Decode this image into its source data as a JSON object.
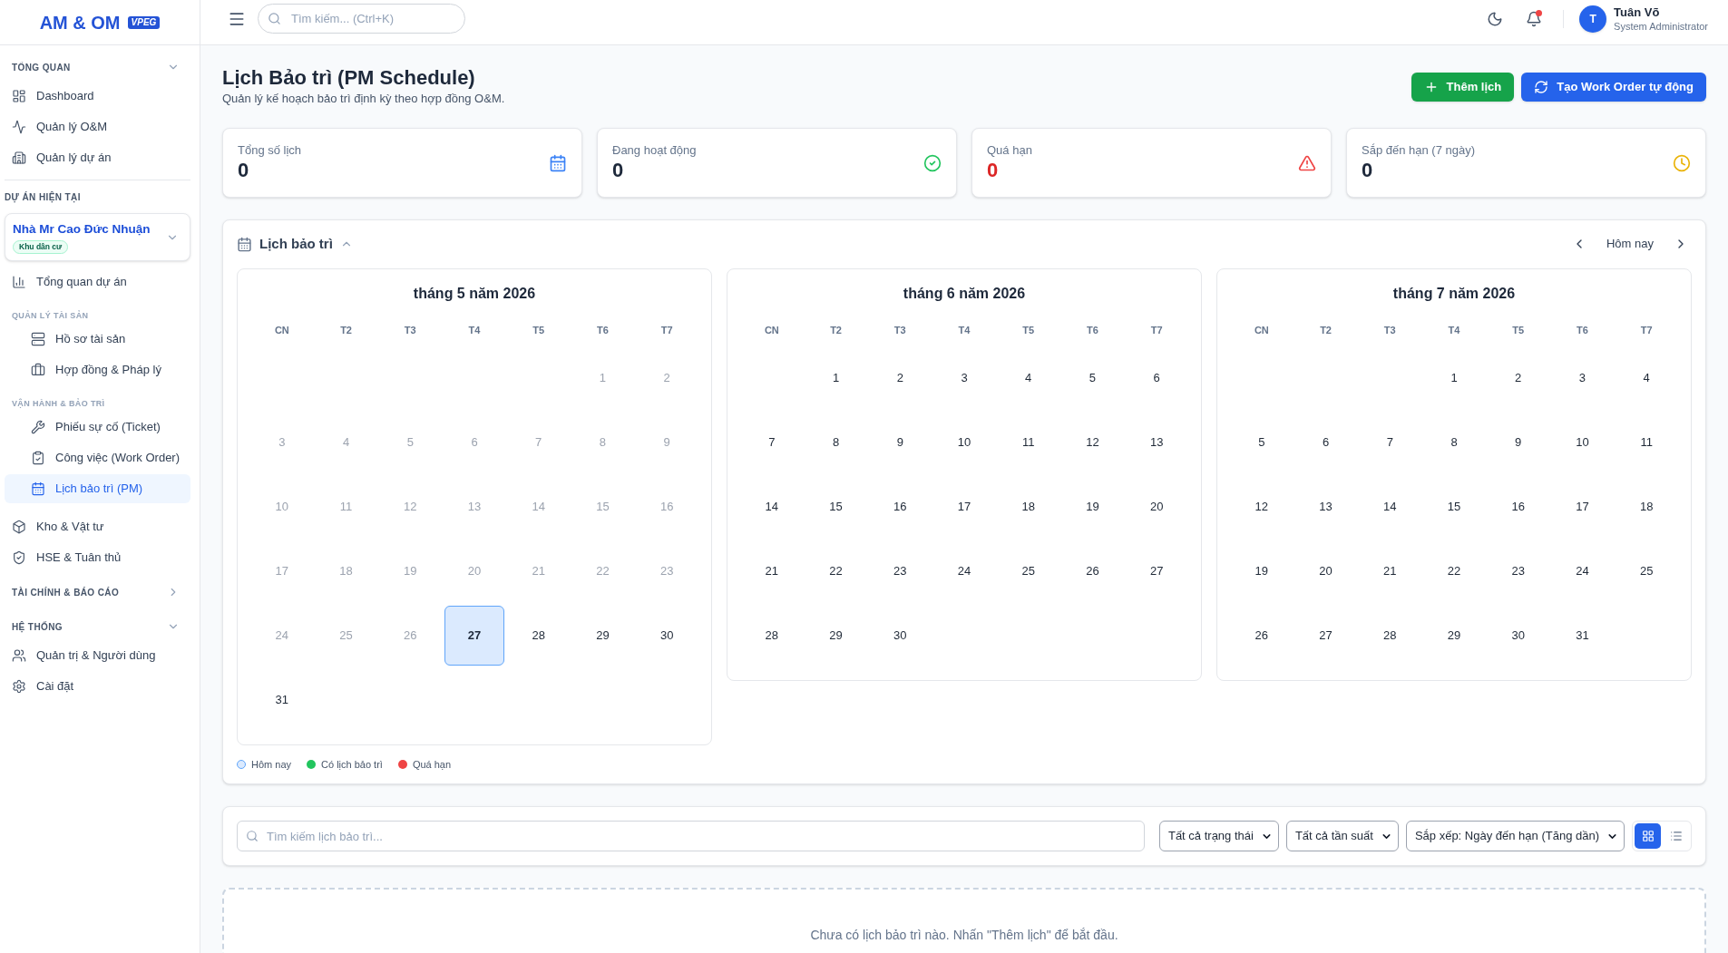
{
  "sidebar": {
    "logo": {
      "title": "AM & OM",
      "badge": "VPEG"
    },
    "sections": [
      {
        "kind": "collapsible",
        "title": "TỔNG QUAN",
        "expanded": true,
        "items": [
          {
            "label": "Dashboard",
            "selected": false
          },
          {
            "label": "Quản lý O&M",
            "selected": false
          },
          {
            "label": "Quản lý dự án",
            "selected": false
          }
        ]
      },
      {
        "kind": "project",
        "title": "DỰ ÁN HIỆN TẠI",
        "project": {
          "name": "Nhà Mr Cao Đức Nhuận",
          "tag": "Khu dân cư"
        },
        "items": [
          {
            "kind": "link",
            "label": "Tổng quan dự án",
            "selected": false
          },
          {
            "kind": "group",
            "title": "QUẢN LÝ TÀI SẢN",
            "items": [
              {
                "label": "Hồ sơ tài sản",
                "selected": false
              },
              {
                "label": "Hợp đồng & Pháp lý",
                "selected": false
              }
            ]
          },
          {
            "kind": "group",
            "title": "VẬN HÀNH & BẢO TRÌ",
            "items": [
              {
                "label": "Phiếu sự cố (Ticket)",
                "selected": false
              },
              {
                "label": "Công việc (Work Order)",
                "selected": false
              },
              {
                "label": "Lịch bảo trì (PM)",
                "selected": true
              }
            ]
          },
          {
            "kind": "link",
            "label": "Kho & Vật tư",
            "selected": false
          },
          {
            "kind": "link",
            "label": "HSE & Tuân thủ",
            "selected": false
          }
        ]
      },
      {
        "kind": "collapsible",
        "title": "TÀI CHÍNH & BÁO CÁO",
        "expanded": false
      },
      {
        "kind": "collapsible",
        "title": "HỆ THỐNG",
        "expanded": true,
        "items": [
          {
            "label": "Quản trị & Người dùng",
            "selected": false
          },
          {
            "label": "Cài đặt",
            "selected": false
          }
        ]
      }
    ]
  },
  "header": {
    "search": {
      "placeholder": "Tìm kiếm... (Ctrl+K)"
    },
    "notifications": {
      "unread": true
    },
    "user": {
      "initial": "T",
      "name": "Tuân Võ",
      "role": "System Administrator"
    }
  },
  "page": {
    "title": "Lịch Bảo trì (PM Schedule)",
    "subtitle": "Quản lý kế hoạch bảo trì định kỳ theo hợp đồng O&M.",
    "actions": [
      {
        "kind": "add",
        "label": "Thêm lịch"
      },
      {
        "kind": "generate",
        "label": "Tạo Work Order tự động"
      }
    ]
  },
  "stats": [
    {
      "kind": "total",
      "label": "Tổng số lịch",
      "value": "0"
    },
    {
      "kind": "active",
      "label": "Đang hoạt động",
      "value": "0"
    },
    {
      "kind": "overdue",
      "label": "Quá hạn",
      "value": "0"
    },
    {
      "kind": "upcoming",
      "label": "Sắp đến hạn (7 ngày)",
      "value": "0"
    }
  ],
  "calendar": {
    "title": "Lịch bảo trì",
    "expanded": true,
    "today_button": "Hôm nay",
    "months": [
      {
        "title": "tháng 5 năm 2026",
        "weekdays": [
          "CN",
          "T2",
          "T3",
          "T4",
          "T5",
          "T6",
          "T7"
        ],
        "weeks": [
          [
            {
              "kind": "blank"
            },
            {
              "kind": "blank"
            },
            {
              "kind": "blank"
            },
            {
              "kind": "blank"
            },
            {
              "kind": "blank"
            },
            {
              "kind": "day",
              "label": "1",
              "past": true,
              "today": false
            },
            {
              "kind": "day",
              "label": "2",
              "past": true,
              "today": false
            }
          ],
          [
            {
              "kind": "day",
              "label": "3",
              "past": true,
              "today": false
            },
            {
              "kind": "day",
              "label": "4",
              "past": true,
              "today": false
            },
            {
              "kind": "day",
              "label": "5",
              "past": true,
              "today": false
            },
            {
              "kind": "day",
              "label": "6",
              "past": true,
              "today": false
            },
            {
              "kind": "day",
              "label": "7",
              "past": true,
              "today": false
            },
            {
              "kind": "day",
              "label": "8",
              "past": true,
              "today": false
            },
            {
              "kind": "day",
              "label": "9",
              "past": true,
              "today": false
            }
          ],
          [
            {
              "kind": "day",
              "label": "10",
              "past": true,
              "today": false
            },
            {
              "kind": "day",
              "label": "11",
              "past": true,
              "today": false
            },
            {
              "kind": "day",
              "label": "12",
              "past": true,
              "today": false
            },
            {
              "kind": "day",
              "label": "13",
              "past": true,
              "today": false
            },
            {
              "kind": "day",
              "label": "14",
              "past": true,
              "today": false
            },
            {
              "kind": "day",
              "label": "15",
              "past": true,
              "today": false
            },
            {
              "kind": "day",
              "label": "16",
              "past": true,
              "today": false
            }
          ],
          [
            {
              "kind": "day",
              "label": "17",
              "past": true,
              "today": false
            },
            {
              "kind": "day",
              "label": "18",
              "past": true,
              "today": false
            },
            {
              "kind": "day",
              "label": "19",
              "past": true,
              "today": false
            },
            {
              "kind": "day",
              "label": "20",
              "past": true,
              "today": false
            },
            {
              "kind": "day",
              "label": "21",
              "past": true,
              "today": false
            },
            {
              "kind": "day",
              "label": "22",
              "past": true,
              "today": false
            },
            {
              "kind": "day",
              "label": "23",
              "past": true,
              "today": false
            }
          ],
          [
            {
              "kind": "day",
              "label": "24",
              "past": true,
              "today": false
            },
            {
              "kind": "day",
              "label": "25",
              "past": true,
              "today": false
            },
            {
              "kind": "day",
              "label": "26",
              "past": true,
              "today": false
            },
            {
              "kind": "day",
              "label": "27",
              "past": false,
              "today": true
            },
            {
              "kind": "day",
              "label": "28",
              "past": false,
              "today": false
            },
            {
              "kind": "day",
              "label": "29",
              "past": false,
              "today": false
            },
            {
              "kind": "day",
              "label": "30",
              "past": false,
              "today": false
            }
          ],
          [
            {
              "kind": "day",
              "label": "31",
              "past": false,
              "today": false
            }
          ]
        ]
      },
      {
        "title": "tháng 6 năm 2026",
        "weekdays": [
          "CN",
          "T2",
          "T3",
          "T4",
          "T5",
          "T6",
          "T7"
        ],
        "weeks": [
          [
            {
              "kind": "blank"
            },
            {
              "kind": "day",
              "label": "1",
              "past": false,
              "today": false
            },
            {
              "kind": "day",
              "label": "2",
              "past": false,
              "today": false
            },
            {
              "kind": "day",
              "label": "3",
              "past": false,
              "today": false
            },
            {
              "kind": "day",
              "label": "4",
              "past": false,
              "today": false
            },
            {
              "kind": "day",
              "label": "5",
              "past": false,
              "today": false
            },
            {
              "kind": "day",
              "label": "6",
              "past": false,
              "today": false
            }
          ],
          [
            {
              "kind": "day",
              "label": "7",
              "past": false,
              "today": false
            },
            {
              "kind": "day",
              "label": "8",
              "past": false,
              "today": false
            },
            {
              "kind": "day",
              "label": "9",
              "past": false,
              "today": false
            },
            {
              "kind": "day",
              "label": "10",
              "past": false,
              "today": false
            },
            {
              "kind": "day",
              "label": "11",
              "past": false,
              "today": false
            },
            {
              "kind": "day",
              "label": "12",
              "past": false,
              "today": false
            },
            {
              "kind": "day",
              "label": "13",
              "past": false,
              "today": false
            }
          ],
          [
            {
              "kind": "day",
              "label": "14",
              "past": false,
              "today": false
            },
            {
              "kind": "day",
              "label": "15",
              "past": false,
              "today": false
            },
            {
              "kind": "day",
              "label": "16",
              "past": false,
              "today": false
            },
            {
              "kind": "day",
              "label": "17",
              "past": false,
              "today": false
            },
            {
              "kind": "day",
              "label": "18",
              "past": false,
              "today": false
            },
            {
              "kind": "day",
              "label": "19",
              "past": false,
              "today": false
            },
            {
              "kind": "day",
              "label": "20",
              "past": false,
              "today": false
            }
          ],
          [
            {
              "kind": "day",
              "label": "21",
              "past": false,
              "today": false
            },
            {
              "kind": "day",
              "label": "22",
              "past": false,
              "today": false
            },
            {
              "kind": "day",
              "label": "23",
              "past": false,
              "today": false
            },
            {
              "kind": "day",
              "label": "24",
              "past": false,
              "today": false
            },
            {
              "kind": "day",
              "label": "25",
              "past": false,
              "today": false
            },
            {
              "kind": "day",
              "label": "26",
              "past": false,
              "today": false
            },
            {
              "kind": "day",
              "label": "27",
              "past": false,
              "today": false
            }
          ],
          [
            {
              "kind": "day",
              "label": "28",
              "past": false,
              "today": false
            },
            {
              "kind": "day",
              "label": "29",
              "past": false,
              "today": false
            },
            {
              "kind": "day",
              "label": "30",
              "past": false,
              "today": false
            }
          ]
        ]
      },
      {
        "title": "tháng 7 năm 2026",
        "weekdays": [
          "CN",
          "T2",
          "T3",
          "T4",
          "T5",
          "T6",
          "T7"
        ],
        "weeks": [
          [
            {
              "kind": "blank"
            },
            {
              "kind": "blank"
            },
            {
              "kind": "blank"
            },
            {
              "kind": "day",
              "label": "1",
              "past": false,
              "today": false
            },
            {
              "kind": "day",
              "label": "2",
              "past": false,
              "today": false
            },
            {
              "kind": "day",
              "label": "3",
              "past": false,
              "today": false
            },
            {
              "kind": "day",
              "label": "4",
              "past": false,
              "today": false
            }
          ],
          [
            {
              "kind": "day",
              "label": "5",
              "past": false,
              "today": false
            },
            {
              "kind": "day",
              "label": "6",
              "past": false,
              "today": false
            },
            {
              "kind": "day",
              "label": "7",
              "past": false,
              "today": false
            },
            {
              "kind": "day",
              "label": "8",
              "past": false,
              "today": false
            },
            {
              "kind": "day",
              "label": "9",
              "past": false,
              "today": false
            },
            {
              "kind": "day",
              "label": "10",
              "past": false,
              "today": false
            },
            {
              "kind": "day",
              "label": "11",
              "past": false,
              "today": false
            }
          ],
          [
            {
              "kind": "day",
              "label": "12",
              "past": false,
              "today": false
            },
            {
              "kind": "day",
              "label": "13",
              "past": false,
              "today": false
            },
            {
              "kind": "day",
              "label": "14",
              "past": false,
              "today": false
            },
            {
              "kind": "day",
              "label": "15",
              "past": false,
              "today": false
            },
            {
              "kind": "day",
              "label": "16",
              "past": false,
              "today": false
            },
            {
              "kind": "day",
              "label": "17",
              "past": false,
              "today": false
            },
            {
              "kind": "day",
              "label": "18",
              "past": false,
              "today": false
            }
          ],
          [
            {
              "kind": "day",
              "label": "19",
              "past": false,
              "today": false
            },
            {
              "kind": "day",
              "label": "20",
              "past": false,
              "today": false
            },
            {
              "kind": "day",
              "label": "21",
              "past": false,
              "today": false
            },
            {
              "kind": "day",
              "label": "22",
              "past": false,
              "today": false
            },
            {
              "kind": "day",
              "label": "23",
              "past": false,
              "today": false
            },
            {
              "kind": "day",
              "label": "24",
              "past": false,
              "today": false
            },
            {
              "kind": "day",
              "label": "25",
              "past": false,
              "today": false
            }
          ],
          [
            {
              "kind": "day",
              "label": "26",
              "past": false,
              "today": false
            },
            {
              "kind": "day",
              "label": "27",
              "past": false,
              "today": false
            },
            {
              "kind": "day",
              "label": "28",
              "past": false,
              "today": false
            },
            {
              "kind": "day",
              "label": "29",
              "past": false,
              "today": false
            },
            {
              "kind": "day",
              "label": "30",
              "past": false,
              "today": false
            },
            {
              "kind": "day",
              "label": "31",
              "past": false,
              "today": false
            }
          ]
        ]
      }
    ],
    "legend": [
      {
        "kind": "outlined",
        "label": "Hôm nay",
        "color": "#dbeafe"
      },
      {
        "kind": "filled",
        "label": "Có lịch bảo trì",
        "color": "#22c55e"
      },
      {
        "kind": "filled",
        "label": "Quá hạn",
        "color": "#ef4444"
      }
    ]
  },
  "filters": {
    "search": {
      "placeholder": "Tìm kiếm lịch bảo trì..."
    },
    "selects": [
      "Tất cả trạng thái",
      "Tất cả tần suất",
      "Sắp xếp: Ngày đến hạn (Tăng dần)"
    ],
    "views": [
      {
        "kind": "grid",
        "selected": true
      },
      {
        "kind": "list",
        "selected": false
      }
    ]
  },
  "empty_state": {
    "message": "Chưa có lịch bảo trì nào. Nhấn \"Thêm lịch\" để bắt đầu."
  }
}
